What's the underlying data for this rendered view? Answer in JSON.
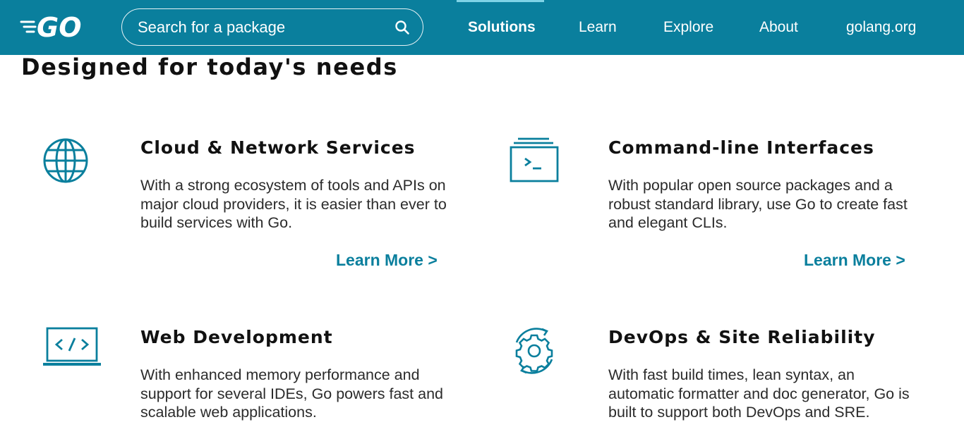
{
  "colors": {
    "brand": "#0a7f9d",
    "link": "#0a7f9d",
    "icon": "#0a7f9d"
  },
  "header": {
    "logo_text": "GO",
    "search": {
      "placeholder": "Search for a package",
      "value": ""
    },
    "nav": [
      {
        "label": "Solutions",
        "active": true
      },
      {
        "label": "Learn",
        "active": false
      },
      {
        "label": "Explore",
        "active": false
      },
      {
        "label": "About",
        "active": false
      },
      {
        "label": "golang.org",
        "active": false
      }
    ]
  },
  "main": {
    "title": "Designed for today's needs",
    "cards": [
      {
        "icon": "globe-icon",
        "title": "Cloud & Network Services",
        "description": "With a strong ecosystem of tools and APIs on major cloud providers, it is easier than ever to build services with Go.",
        "link": "Learn More >"
      },
      {
        "icon": "terminal-icon",
        "title": "Command-line Interfaces",
        "description": "With popular open source packages and a robust standard library, use Go to create fast and elegant CLIs.",
        "link": "Learn More >"
      },
      {
        "icon": "code-laptop-icon",
        "title": "Web Development",
        "description": "With enhanced memory performance and support for several IDEs, Go powers fast and scalable web applications."
      },
      {
        "icon": "gear-cycle-icon",
        "title": "DevOps & Site Reliability",
        "description": "With fast build times, lean syntax, an automatic formatter and doc generator, Go is built to support both DevOps and SRE."
      }
    ]
  }
}
